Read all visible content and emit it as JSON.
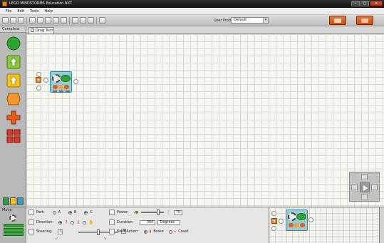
{
  "window": {
    "title": "LEGO MINDSTORMS Education NXT",
    "controls": [
      "–",
      "□",
      "✕"
    ]
  },
  "menu": [
    "File",
    "Edit",
    "Tools",
    "Help"
  ],
  "toolbar": {
    "profile_label": "User Profile:",
    "profile_value": "Default"
  },
  "palette": {
    "label": "Complete",
    "items": [
      {
        "icon": "move-block-icon",
        "color": "#2fa12f"
      },
      {
        "icon": "record-play-icon",
        "color": "#86c83a"
      },
      {
        "icon": "wait-icon",
        "color": "#f3c21a"
      },
      {
        "icon": "loop-icon",
        "color": "#f3962b"
      },
      {
        "icon": "switch-icon",
        "color": "#ea5a17"
      },
      {
        "icon": "custom-palette-icon",
        "color": "#d83b25"
      }
    ]
  },
  "document": {
    "tab_label": "Drag Turn"
  },
  "config": {
    "block_name": "Move",
    "port_label": "Port:",
    "ports": [
      "A",
      "B",
      "C"
    ],
    "direction_label": "Direction:",
    "steering_label": "Steering:",
    "steering_left": "C",
    "steering_right": "B",
    "power_label": "Power:",
    "power_value": "75",
    "duration_label": "Duration:",
    "duration_value": "360",
    "duration_unit": "Degrees",
    "next_action_label": "Next Action:",
    "brake_label": "Brake",
    "coast_label": "Coast",
    "port_rows": [
      "A",
      "B",
      "C"
    ]
  },
  "colors": {
    "accent_orange": "#d4561b",
    "block_teal": "#97cbd0",
    "motor_green": "#33a332"
  }
}
